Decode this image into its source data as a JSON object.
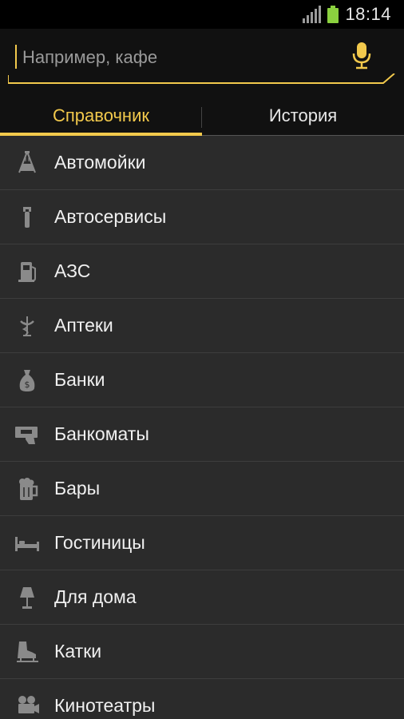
{
  "status_bar": {
    "time": "18:14",
    "battery_color": "#8bd13f"
  },
  "search": {
    "placeholder": "Например, кафе",
    "value": "",
    "accent_color": "#f2c94c"
  },
  "tabs": [
    {
      "label": "Справочник",
      "active": true
    },
    {
      "label": "История",
      "active": false
    }
  ],
  "categories": [
    {
      "label": "Автомойки",
      "icon": "car-wash-icon"
    },
    {
      "label": "Автосервисы",
      "icon": "wrench-icon"
    },
    {
      "label": "АЗС",
      "icon": "gas-station-icon"
    },
    {
      "label": "Аптеки",
      "icon": "pharmacy-icon"
    },
    {
      "label": "Банки",
      "icon": "money-bag-icon"
    },
    {
      "label": "Банкоматы",
      "icon": "atm-icon"
    },
    {
      "label": "Бары",
      "icon": "beer-mug-icon"
    },
    {
      "label": "Гостиницы",
      "icon": "bed-icon"
    },
    {
      "label": "Для дома",
      "icon": "lamp-icon"
    },
    {
      "label": "Катки",
      "icon": "ice-skate-icon"
    },
    {
      "label": "Кинотеатры",
      "icon": "movie-camera-icon"
    }
  ]
}
